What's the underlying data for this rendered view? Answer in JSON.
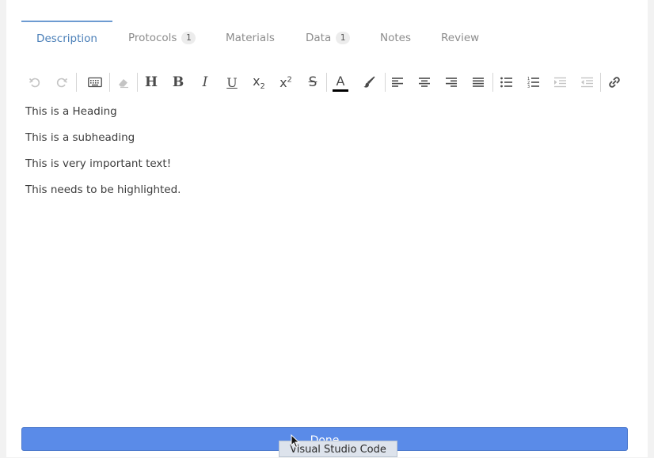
{
  "tabs": [
    {
      "label": "Description",
      "badge": null,
      "active": true
    },
    {
      "label": "Protocols",
      "badge": "1",
      "active": false
    },
    {
      "label": "Materials",
      "badge": null,
      "active": false
    },
    {
      "label": "Data",
      "badge": "1",
      "active": false
    },
    {
      "label": "Notes",
      "badge": null,
      "active": false
    },
    {
      "label": "Review",
      "badge": null,
      "active": false
    }
  ],
  "toolbar": {
    "heading_glyph": "H",
    "bold_glyph": "B",
    "italic_glyph": "I",
    "underline_glyph": "U",
    "subscript_glyph": "x",
    "subscript_sub": "2",
    "superscript_glyph": "x",
    "superscript_sup": "2",
    "strike_glyph": "S",
    "font_color_glyph": "A",
    "font_color": "#000000"
  },
  "editor": {
    "paragraphs": [
      "This is a Heading",
      "This is a subheading",
      "This is very important text!",
      "This needs to be highlighted."
    ]
  },
  "done_label": "Done",
  "tooltip_text": "Visual Studio Code",
  "colors": {
    "accent": "#5a8be8",
    "active_tab": "#4a7fb8"
  }
}
